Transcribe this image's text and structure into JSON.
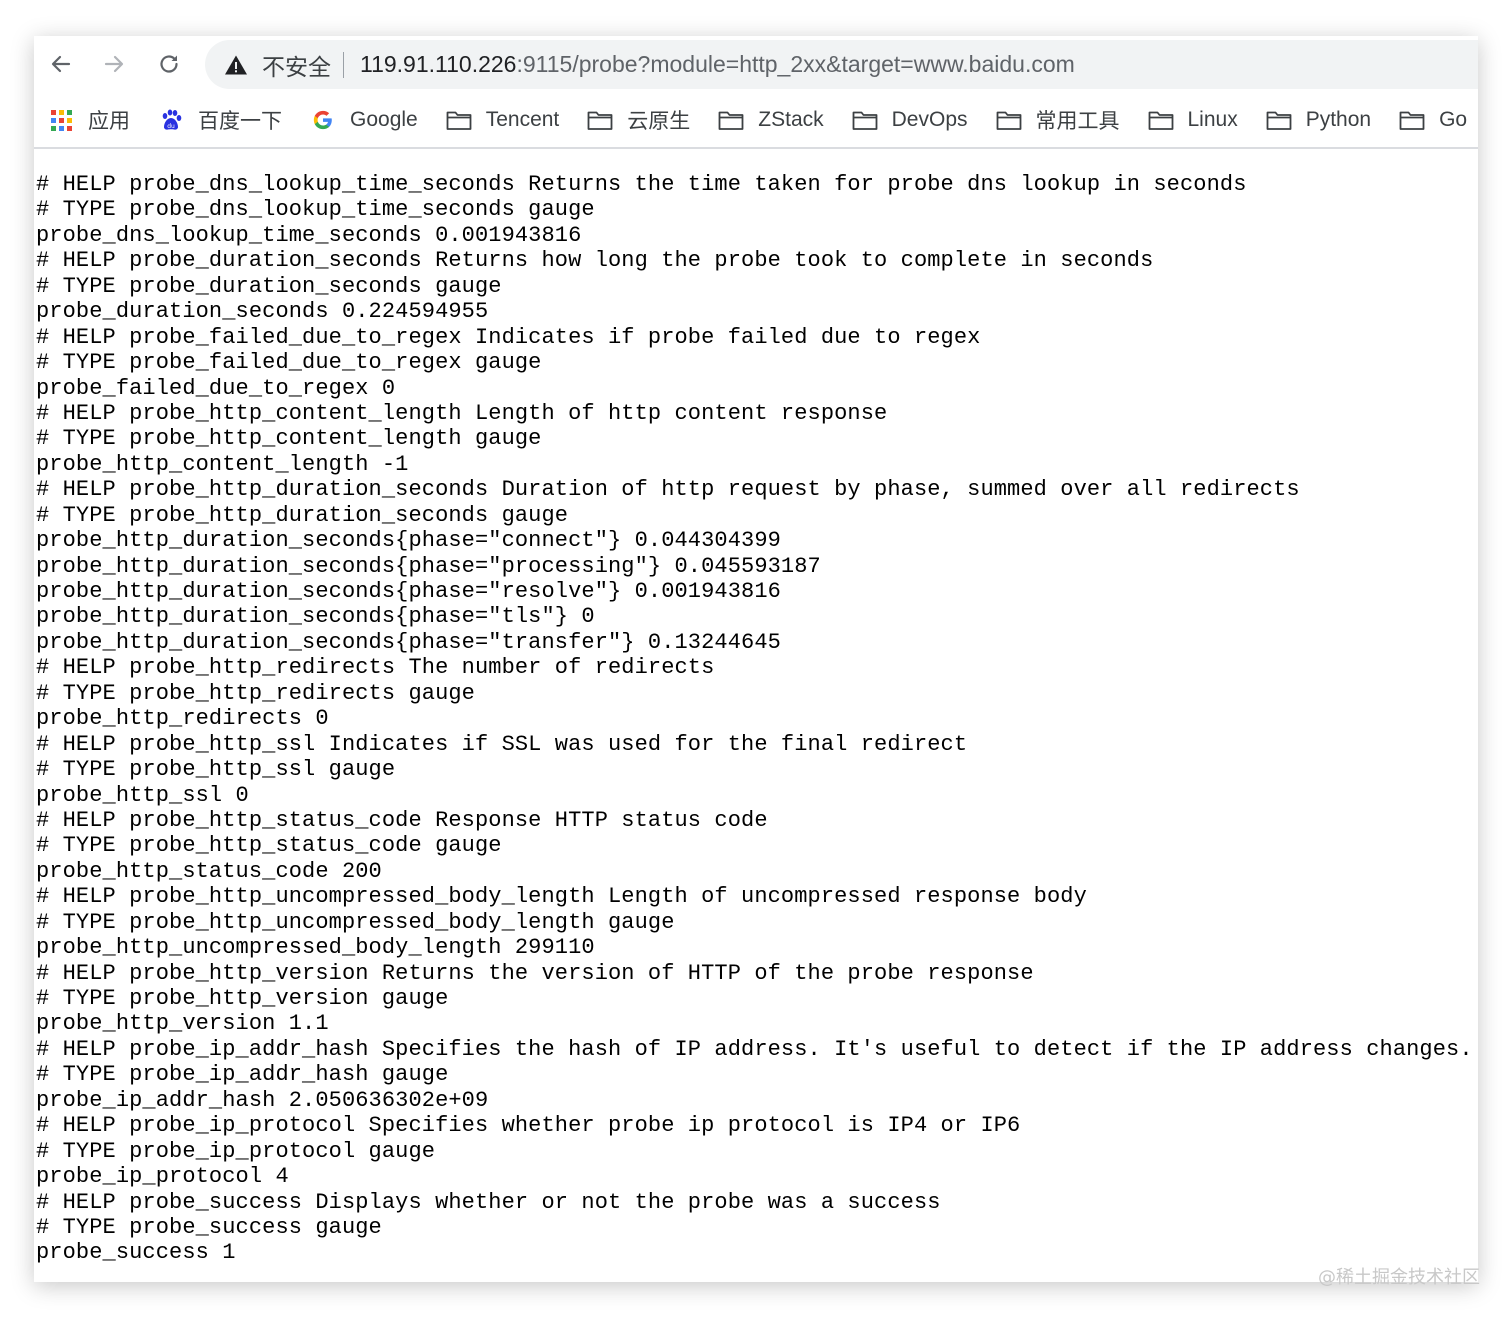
{
  "browser": {
    "security_label": "不安全",
    "url_host": "119.91.110.226",
    "url_rest": ":9115/probe?module=http_2xx&target=www.baidu.com"
  },
  "bookmarks": [
    {
      "label": "应用",
      "icon": "apps-grid-icon"
    },
    {
      "label": "百度一下",
      "icon": "baidu-paw-icon"
    },
    {
      "label": "Google",
      "icon": "google-g-icon"
    },
    {
      "label": "Tencent",
      "icon": "folder-icon"
    },
    {
      "label": "云原生",
      "icon": "folder-icon"
    },
    {
      "label": "ZStack",
      "icon": "folder-icon"
    },
    {
      "label": "DevOps",
      "icon": "folder-icon"
    },
    {
      "label": "常用工具",
      "icon": "folder-icon"
    },
    {
      "label": "Linux",
      "icon": "folder-icon"
    },
    {
      "label": "Python",
      "icon": "folder-icon"
    },
    {
      "label": "Go",
      "icon": "folder-icon"
    }
  ],
  "lines": [
    "# HELP probe_dns_lookup_time_seconds Returns the time taken for probe dns lookup in seconds",
    "# TYPE probe_dns_lookup_time_seconds gauge",
    "probe_dns_lookup_time_seconds 0.001943816",
    "# HELP probe_duration_seconds Returns how long the probe took to complete in seconds",
    "# TYPE probe_duration_seconds gauge",
    "probe_duration_seconds 0.224594955",
    "# HELP probe_failed_due_to_regex Indicates if probe failed due to regex",
    "# TYPE probe_failed_due_to_regex gauge",
    "probe_failed_due_to_regex 0",
    "# HELP probe_http_content_length Length of http content response",
    "# TYPE probe_http_content_length gauge",
    "probe_http_content_length -1",
    "# HELP probe_http_duration_seconds Duration of http request by phase, summed over all redirects",
    "# TYPE probe_http_duration_seconds gauge",
    "probe_http_duration_seconds{phase=\"connect\"} 0.044304399",
    "probe_http_duration_seconds{phase=\"processing\"} 0.045593187",
    "probe_http_duration_seconds{phase=\"resolve\"} 0.001943816",
    "probe_http_duration_seconds{phase=\"tls\"} 0",
    "probe_http_duration_seconds{phase=\"transfer\"} 0.13244645",
    "# HELP probe_http_redirects The number of redirects",
    "# TYPE probe_http_redirects gauge",
    "probe_http_redirects 0",
    "# HELP probe_http_ssl Indicates if SSL was used for the final redirect",
    "# TYPE probe_http_ssl gauge",
    "probe_http_ssl 0",
    "# HELP probe_http_status_code Response HTTP status code",
    "# TYPE probe_http_status_code gauge",
    "probe_http_status_code 200",
    "# HELP probe_http_uncompressed_body_length Length of uncompressed response body",
    "# TYPE probe_http_uncompressed_body_length gauge",
    "probe_http_uncompressed_body_length 299110",
    "# HELP probe_http_version Returns the version of HTTP of the probe response",
    "# TYPE probe_http_version gauge",
    "probe_http_version 1.1",
    "# HELP probe_ip_addr_hash Specifies the hash of IP address. It's useful to detect if the IP address changes.",
    "# TYPE probe_ip_addr_hash gauge",
    "probe_ip_addr_hash 2.050636302e+09",
    "# HELP probe_ip_protocol Specifies whether probe ip protocol is IP4 or IP6",
    "# TYPE probe_ip_protocol gauge",
    "probe_ip_protocol 4",
    "# HELP probe_success Displays whether or not the probe was a success",
    "# TYPE probe_success gauge",
    "probe_success 1"
  ],
  "watermark": "@稀土掘金技术社区"
}
